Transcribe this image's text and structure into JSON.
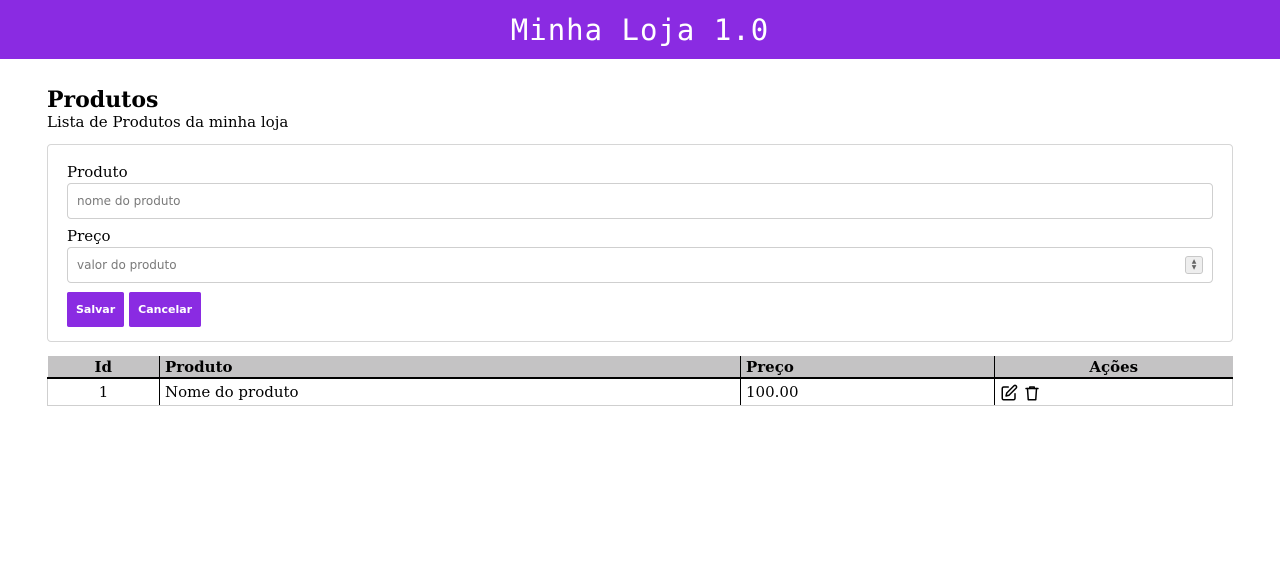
{
  "app": {
    "title": "Minha Loja 1.0",
    "accent_color": "#8a2be2"
  },
  "page": {
    "title": "Produtos",
    "subtitle": "Lista de Produtos da minha loja"
  },
  "form": {
    "product_label": "Produto",
    "product_placeholder": "nome do produto",
    "price_label": "Preço",
    "price_placeholder": "valor do produto",
    "save_label": "Salvar",
    "cancel_label": "Cancelar"
  },
  "table": {
    "headers": [
      "Id",
      "Produto",
      "Preço",
      "Ações"
    ],
    "rows": [
      {
        "id": "1",
        "product": "Nome do produto",
        "price": "100.00",
        "actions": [
          "edit-icon",
          "trash-icon"
        ]
      }
    ]
  }
}
